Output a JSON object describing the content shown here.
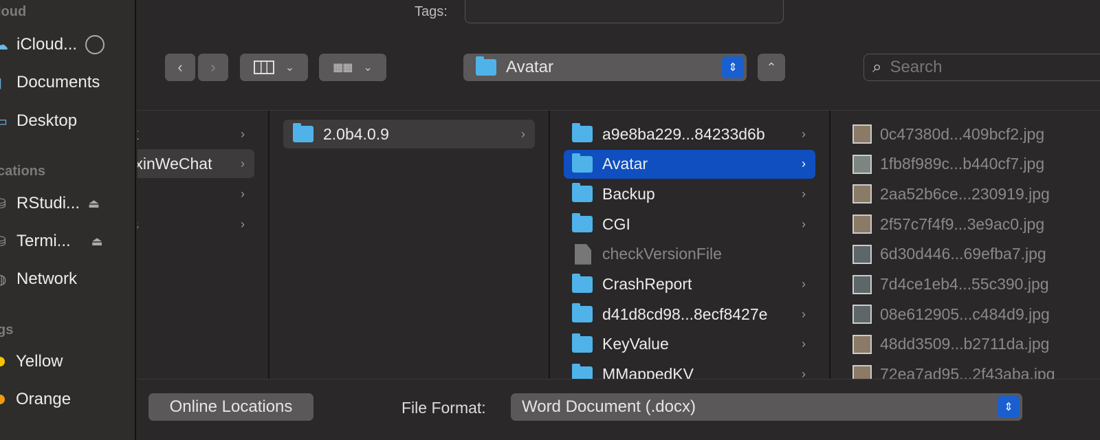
{
  "sidebar": {
    "sections": {
      "icloud": "loud",
      "locations": "cations",
      "tags": "gs"
    },
    "items": [
      {
        "label": "iCloud...",
        "icon": "cloud-icon"
      },
      {
        "label": "Documents",
        "icon": "document-icon"
      },
      {
        "label": "Desktop",
        "icon": "desktop-icon"
      },
      {
        "label": "RStudi...",
        "icon": "disk-icon"
      },
      {
        "label": "Termi...",
        "icon": "disk-icon"
      },
      {
        "label": "Network",
        "icon": "network-icon"
      }
    ],
    "tags": [
      {
        "label": "Yellow",
        "color": "#f5c400"
      },
      {
        "label": "Orange",
        "color": "#f29a0c"
      }
    ]
  },
  "header": {
    "tags_label": "Tags:",
    "tags_value": "",
    "path": "Avatar",
    "search_placeholder": "Search"
  },
  "columns": {
    "col1": [
      {
        "label": "k"
      },
      {
        "label": ".xinWeChat"
      },
      {
        "label": ""
      },
      {
        "label": "s"
      }
    ],
    "col2": [
      {
        "label": "2.0b4.0.9"
      }
    ],
    "col3": [
      {
        "label": "a9e8ba229...84233d6b",
        "type": "folder"
      },
      {
        "label": "Avatar",
        "type": "folder",
        "selected": true
      },
      {
        "label": "Backup",
        "type": "folder"
      },
      {
        "label": "CGI",
        "type": "folder"
      },
      {
        "label": "checkVersionFile",
        "type": "file"
      },
      {
        "label": "CrashReport",
        "type": "folder"
      },
      {
        "label": "d41d8cd98...8ecf8427e",
        "type": "folder"
      },
      {
        "label": "KeyValue",
        "type": "folder"
      },
      {
        "label": "MMappedKV",
        "type": "folder"
      }
    ],
    "col4": [
      "0c47380d...409bcf2.jpg",
      "1fb8f989c...b440cf7.jpg",
      "2aa52b6ce...230919.jpg",
      "2f57c7f4f9...3e9ac0.jpg",
      "6d30d446...69efba7.jpg",
      "7d4ce1eb4...55c390.jpg",
      "08e612905...c484d9.jpg",
      "48dd3509...b2711da.jpg",
      "72ea7ad95...2f43aba.jpg"
    ]
  },
  "footer": {
    "online_locations": "Online Locations",
    "file_format_label": "File Format:",
    "file_format_value": "Word Document (.docx)"
  },
  "colors": {
    "accent": "#1a5fd0",
    "selection": "#0f4fc0",
    "folder": "#4fb3ea"
  }
}
